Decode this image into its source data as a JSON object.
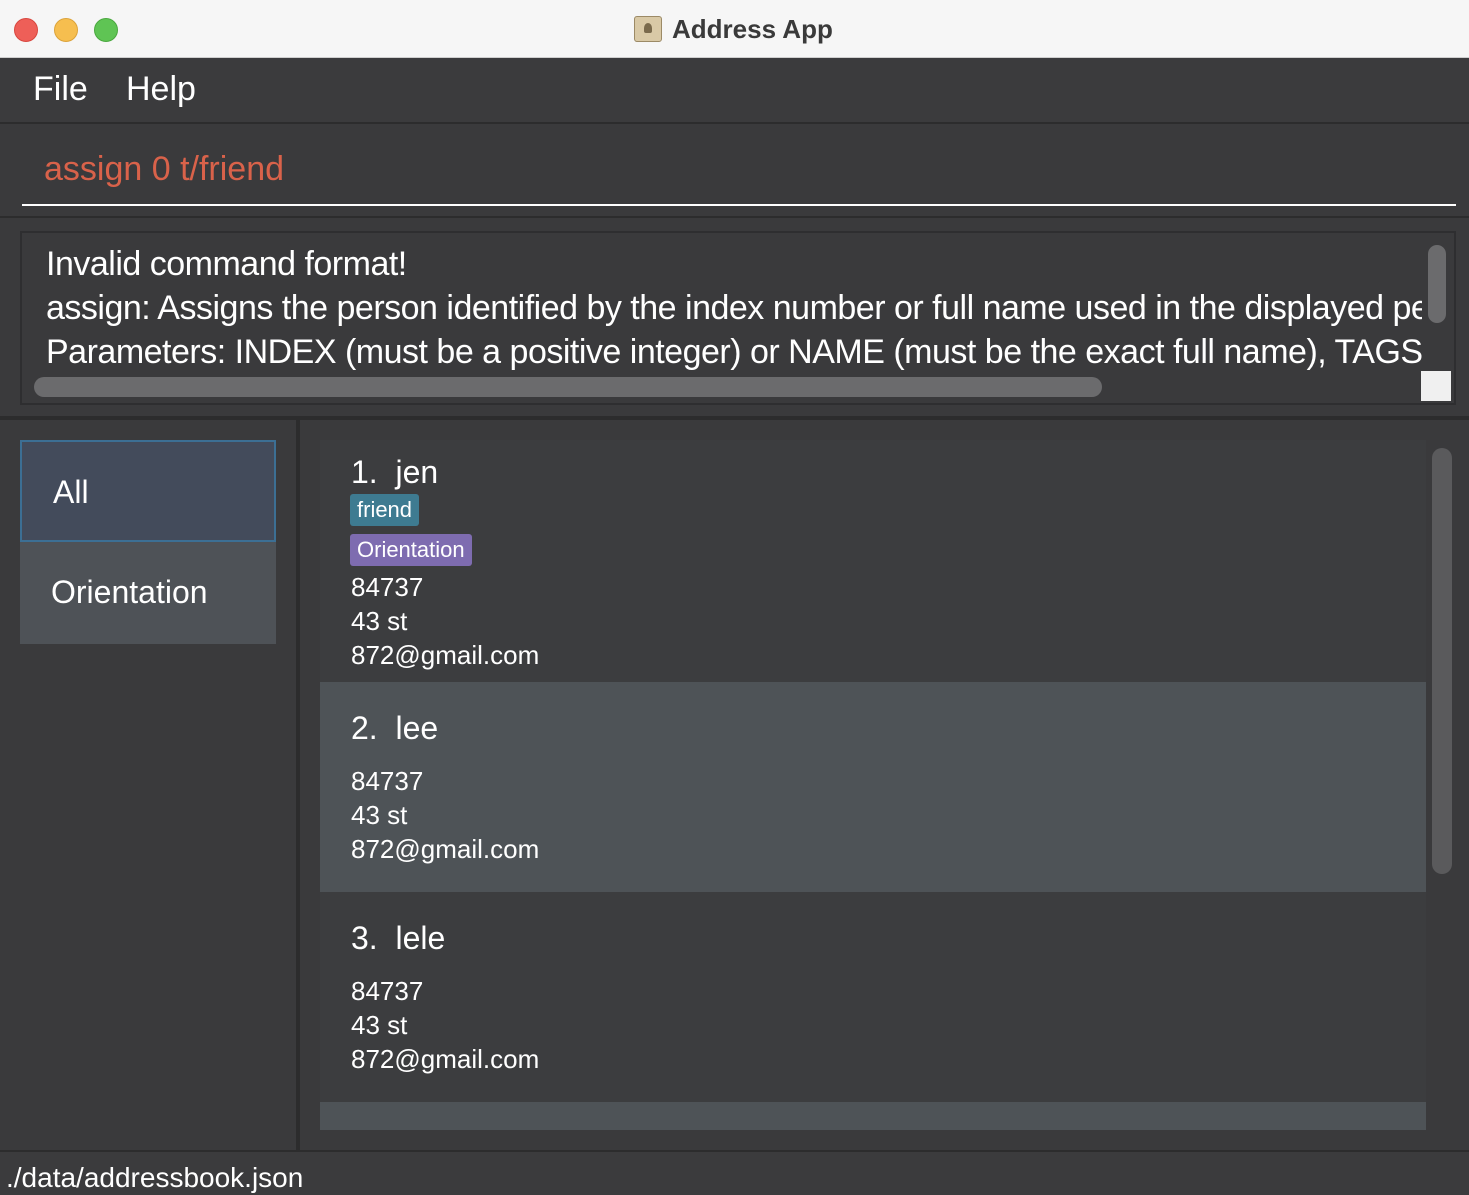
{
  "window": {
    "title": "Address App",
    "icon": "address-book-icon"
  },
  "menu": {
    "file": "File",
    "help": "Help"
  },
  "command": {
    "value": "assign 0 t/friend",
    "color": "#d9624a"
  },
  "result": {
    "lines": [
      "Invalid command format!",
      "assign: Assigns the person identified by the index number or full name used in the displayed pers",
      "Parameters: INDEX (must be a positive integer) or NAME (must be the exact full name), TAGS (t/"
    ]
  },
  "sidebar": {
    "items": [
      {
        "label": "All",
        "selected": true
      },
      {
        "label": "Orientation",
        "selected": false
      }
    ]
  },
  "persons": [
    {
      "index": "1.",
      "name": "jen",
      "tags": [
        {
          "label": "friend",
          "color": "#3e7b91"
        },
        {
          "label": "Orientation",
          "color": "#7e6cb0"
        }
      ],
      "phone": "84737",
      "address": "43 st",
      "email": "872@gmail.com"
    },
    {
      "index": "2.",
      "name": "lee",
      "tags": [],
      "phone": "84737",
      "address": "43 st",
      "email": "872@gmail.com"
    },
    {
      "index": "3.",
      "name": "lele",
      "tags": [],
      "phone": "84737",
      "address": "43 st",
      "email": "872@gmail.com"
    }
  ],
  "status": {
    "file_path": "./data/addressbook.json"
  }
}
